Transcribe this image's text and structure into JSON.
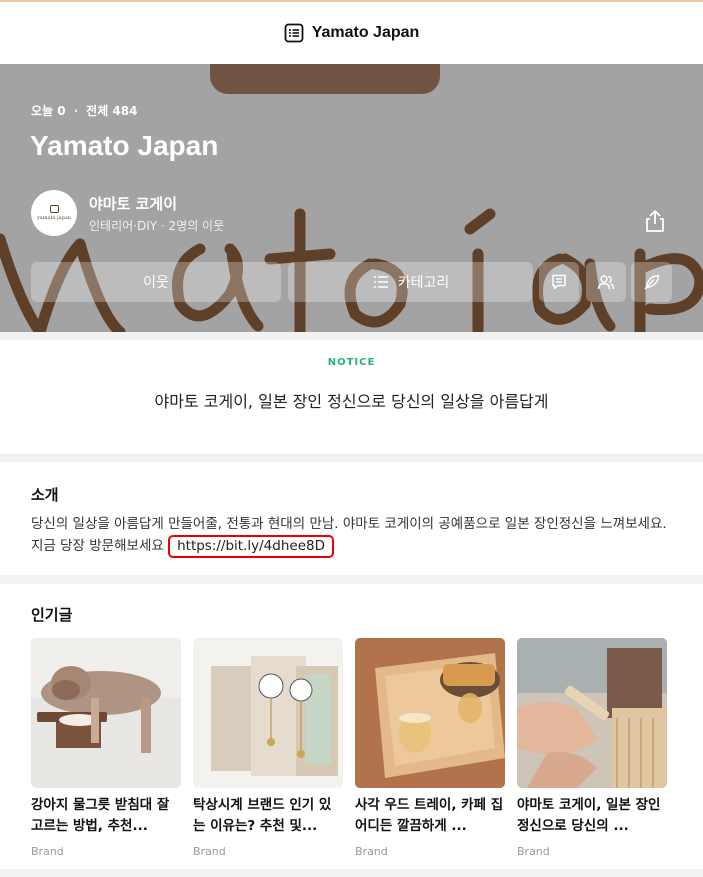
{
  "header": {
    "title": "Yamato Japan",
    "icon": "blog-list-icon"
  },
  "cover": {
    "stats": {
      "today_label": "오늘 0",
      "total_label": "전체 484"
    },
    "title": "Yamato Japan",
    "owner": {
      "name": "야마토 코게이",
      "meta": "인테리어·DIY · 2명의 이웃",
      "avatar_text": "yamato japan"
    },
    "actions": {
      "neighbor_label": "이웃",
      "category_label": "카테고리"
    }
  },
  "notice": {
    "tag": "NOTICE",
    "text": "야마토 코게이, 일본 장인 정신으로 당신의 일상을 아름답게"
  },
  "intro": {
    "heading": "소개",
    "body": "당신의 일상을 아름답게 만들어줄, 전통과 현대의 만남. 야마토 코게이의 공예품으로 일본 장인정신을 느껴보세요. 지금 당장 방문해보세요",
    "link": "https://bit.ly/4dhee8D"
  },
  "popular": {
    "heading": "인기글",
    "posts": [
      {
        "title": "강아지 물그릇 받침대 잘 고르는 방법, 추천...",
        "source": "Brand"
      },
      {
        "title": "탁상시계 브랜드 인기 있는 이유는? 추천 및...",
        "source": "Brand"
      },
      {
        "title": "사각 우드 트레이, 카페 집 어디든 깔끔하게 ...",
        "source": "Brand"
      },
      {
        "title": "야마토 코게이, 일본 장인 정신으로 당신의 ...",
        "source": "Brand"
      }
    ]
  },
  "colors": {
    "notice_tag": "#22b573",
    "cover_gray": "#a3a3a3",
    "brand_brown": "#5b3a22",
    "highlight_red": "#e00000"
  }
}
